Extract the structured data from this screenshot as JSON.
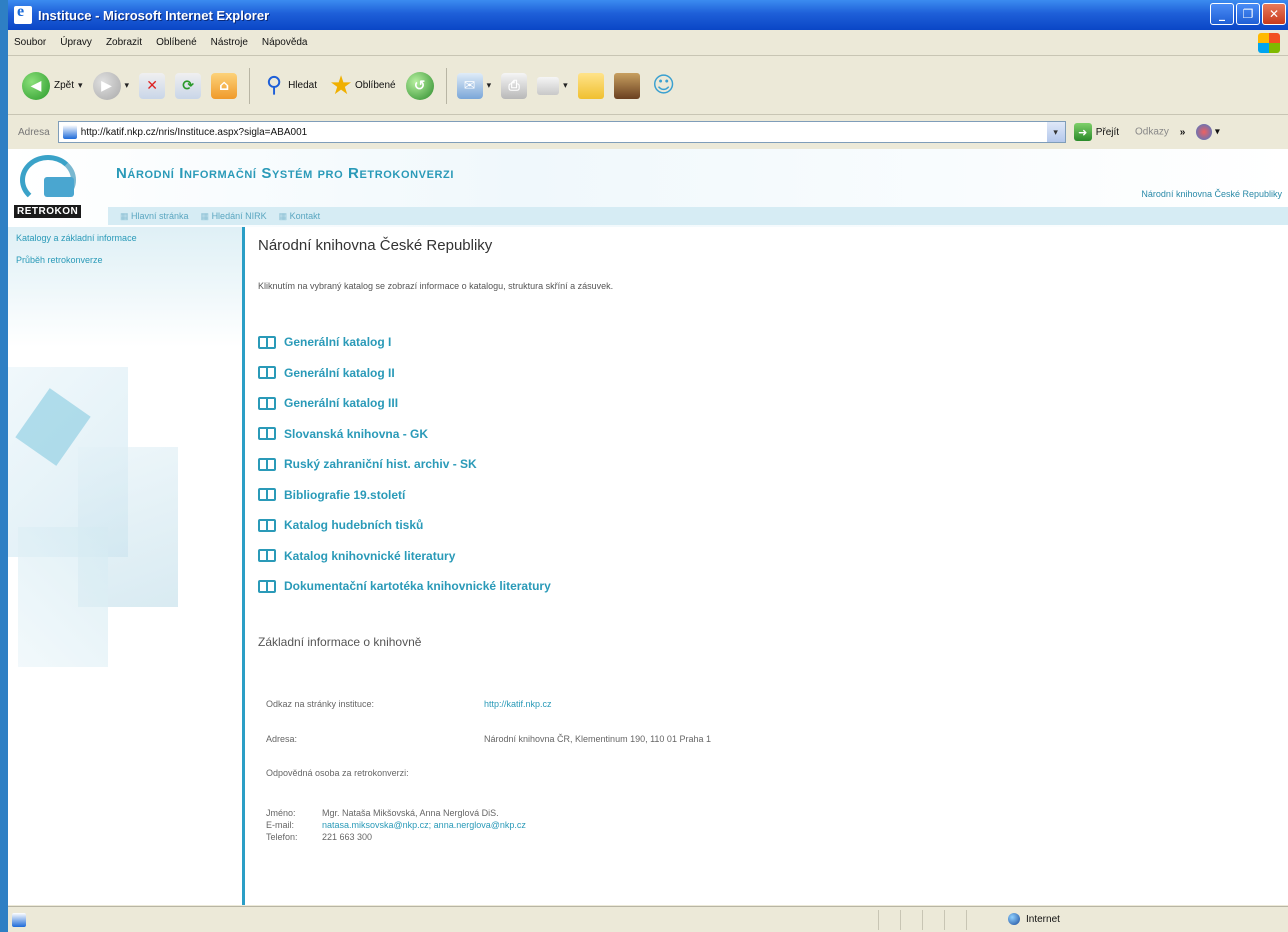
{
  "window": {
    "title": "Instituce - Microsoft Internet Explorer",
    "buttons": {
      "minimize": "_",
      "maximize": "❐",
      "close": "✕"
    }
  },
  "menu": [
    "Soubor",
    "Úpravy",
    "Zobrazit",
    "Oblíbené",
    "Nástroje",
    "Nápověda"
  ],
  "toolbar": {
    "back_label": "Zpět",
    "search_label": "Hledat",
    "favorites_label": "Oblíbené",
    "icons": [
      "back-icon",
      "forward-icon",
      "stop-icon",
      "refresh-icon",
      "home-icon",
      "search-icon",
      "star-icon",
      "history-icon",
      "mail-icon",
      "print-icon",
      "edit-icon",
      "folder-icon",
      "book-icon",
      "messenger-icon"
    ]
  },
  "address": {
    "label": "Adresa",
    "url": "http://katif.nkp.cz/nris/Instituce.aspx?sigla=ABA001",
    "go_label": "Přejít",
    "links_label": "Odkazy"
  },
  "site": {
    "logo_text": "RETROKON",
    "title": "Národní Informační Systém pro Retrokonverzi",
    "institution_header": "Národní knihovna České Republiky",
    "nav": [
      "Hlavní stránka",
      "Hledání NIRK",
      "Kontakt"
    ],
    "sidebar": [
      "Katalogy a základní informace",
      "Průběh retrokonverze"
    ]
  },
  "main": {
    "institution": "Národní knihovna České Republiky",
    "hint": "Kliknutím na vybraný katalog se zobrazí informace o katalogu, struktura skříní a zásuvek.",
    "catalogs": [
      "Generální katalog I",
      "Generální katalog II",
      "Generální katalog III",
      "Slovanská knihovna - GK",
      "Ruský zahraniční hist. archiv - SK",
      "Bibliografie 19.století",
      "Katalog hudebních tisků",
      "Katalog knihovnické literatury",
      "Dokumentační kartotéka knihovnické literatury"
    ],
    "basic_info_heading": "Základní informace o knihovně",
    "web_label": "Odkaz na stránky instituce:",
    "web_value": "http://katif.nkp.cz",
    "address_label": "Adresa:",
    "address_value": "Národní knihovna ČR, Klementinum 190, 110 01 Praha 1",
    "responsible_label": "Odpovědná osoba za retrokonverzi:",
    "contact": {
      "name_label": "Jméno:",
      "name_value": "Mgr. Nataša Mikšovská, Anna Nerglová DiS.",
      "email_label": "E-mail:",
      "email_value": "natasa.miksovska@nkp.cz; anna.nerglova@nkp.cz",
      "phone_label": "Telefon:",
      "phone_value": "221 663 300"
    }
  },
  "status": {
    "zone": "Internet"
  }
}
